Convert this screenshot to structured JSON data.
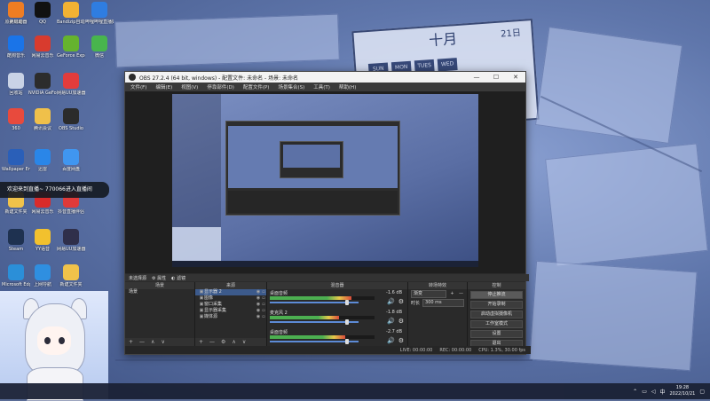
{
  "desktop": {
    "icons": [
      {
        "label": "此电脑",
        "color": "#4a8fe0"
      },
      {
        "label": "QQ",
        "color": "#111111"
      },
      {
        "label": "Bandizip自动解压",
        "color": "#f2b233"
      },
      {
        "label": "哔哩哔哩直播姬",
        "color": "#2f7de1"
      },
      {
        "label": "酷狗音乐",
        "color": "#1a74e8"
      },
      {
        "label": "网易云音乐",
        "color": "#d83b2e"
      },
      {
        "label": "GeForce Experience",
        "color": "#65b32e"
      },
      {
        "label": "微信",
        "color": "#48b54d"
      },
      {
        "label": "回收站",
        "color": "#c9d3e6"
      },
      {
        "label": "NVIDIA GeForce",
        "color": "#2c2c2c"
      },
      {
        "label": "网易UU加速器",
        "color": "#e23c3c"
      },
      {
        "label": "360",
        "color": "#e84a3d"
      },
      {
        "label": "腾讯会议",
        "color": "#f0c04a"
      },
      {
        "label": "OBS Studio",
        "color": "#2b2b2b"
      },
      {
        "label": "Wallpaper Engine",
        "color": "#2a5fb8"
      },
      {
        "label": "迅雷",
        "color": "#2a86e8"
      },
      {
        "label": "百度网盘",
        "color": "#4096f0"
      },
      {
        "label": "新建文件夹",
        "color": "#f0c24a"
      },
      {
        "label": "网易云音乐",
        "color": "#d92b2b"
      },
      {
        "label": "抖音直播伴侣",
        "color": "#e03a3a"
      },
      {
        "label": "Steam",
        "color": "#1e3150"
      },
      {
        "label": "YY语音",
        "color": "#f2c12e"
      },
      {
        "label": "网易UU加速器",
        "color": "#2f2f4a"
      },
      {
        "label": "Microsoft Edge",
        "color": "#2b8fd8"
      },
      {
        "label": "上网导航",
        "color": "#2f8fe0"
      },
      {
        "label": "新建文件夹",
        "color": "#f0c24a"
      },
      {
        "label": "原神启动器",
        "color": "#ef7d23"
      }
    ],
    "notification": "欢迎来到直播~ 770066进入直播间"
  },
  "calendar": {
    "month": "十月",
    "days": [
      "SUN",
      "MON",
      "TUES",
      "WED"
    ],
    "date": "21日"
  },
  "obs": {
    "title": "OBS 27.2.4 (64 bit, windows) - 配置文件: 未命名 - 场景: 未命名",
    "window_controls": [
      "—",
      "☐",
      "✕"
    ],
    "menu": [
      "文件(F)",
      "编辑(E)",
      "视图(V)",
      "停靠部件(D)",
      "配置文件(P)",
      "场景集合(S)",
      "工具(T)",
      "帮助(H)"
    ],
    "source_toolbar": {
      "properties": "属性",
      "filters": "滤镜",
      "label": "未选择源"
    },
    "scenes": {
      "header": "场景",
      "items": [
        "场景"
      ],
      "footer": [
        "+",
        "—",
        "∧",
        "∨"
      ]
    },
    "sources": {
      "header": "来源",
      "items": [
        {
          "name": "显示器 2",
          "selected": true
        },
        {
          "name": "图像"
        },
        {
          "name": "窗口采集"
        },
        {
          "name": "显示器采集"
        },
        {
          "name": "媒体源"
        }
      ],
      "footer": [
        "+",
        "—",
        "⚙",
        "∧",
        "∨"
      ]
    },
    "mixer": {
      "header": "混音器",
      "channels": [
        {
          "name": "桌面音频",
          "value": "-1.6 dB",
          "level": 0.78,
          "fader": 0.85
        },
        {
          "name": "麦克风 2",
          "value": "-1.8 dB",
          "level": 0.66,
          "fader": 0.85
        },
        {
          "name": "桌面音频",
          "value": "-2.7 dB",
          "level": 0.72,
          "fader": 0.85
        }
      ]
    },
    "transitions": {
      "header": "转场特效",
      "type": "渐变",
      "duration_label": "时长",
      "duration": "300 ms"
    },
    "controls": {
      "header": "控制",
      "buttons": [
        {
          "label": "停止推流",
          "active": true
        },
        {
          "label": "开始录制"
        },
        {
          "label": "启动虚拟摄像机"
        },
        {
          "label": "工作室模式"
        },
        {
          "label": "设置"
        },
        {
          "label": "退出"
        }
      ]
    },
    "status": {
      "live": "LIVE: 00:00:00",
      "rec": "REC: 00:00:00",
      "cpu": "CPU: 1.3%, 30.00 fps"
    }
  },
  "taskbar": {
    "time": "19:28",
    "date": "2022/10/21"
  }
}
